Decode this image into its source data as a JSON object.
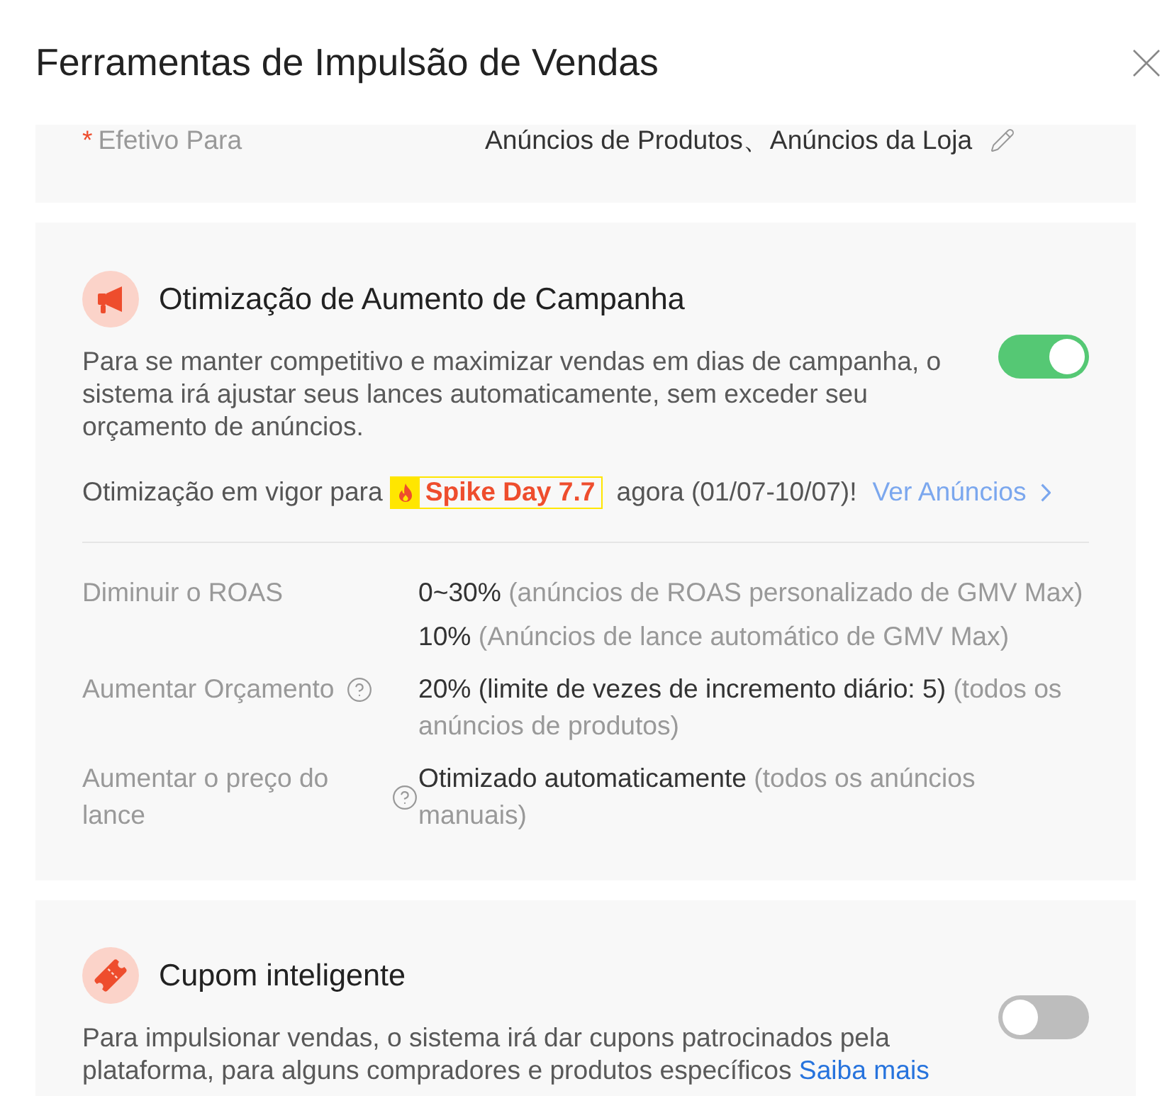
{
  "dialog": {
    "title": "Ferramentas de Impulsão de Vendas"
  },
  "target": {
    "required_mark": "*",
    "label": "Efetivo Para",
    "value": "Anúncios de Produtos、Anúncios da Loja"
  },
  "features": [
    {
      "kind": "boost",
      "title": "Otimização de Aumento de Campanha",
      "enabled": true,
      "description": "Para se manter competitivo e maximizar vendas em dias de campanha, o sistema irá ajustar seus lances automaticamente, sem exceder seu orçamento de anúncios.",
      "promo": {
        "prefix": "Otimização em vigor para",
        "event": "Spike Day 7.7",
        "suffix": "agora (01/07-10/07)!",
        "link": "Ver Anúncios"
      },
      "details": [
        {
          "label": "Diminuir o ROAS",
          "has_help": false,
          "values": [
            {
              "main": "0~30%",
              "note": "(anúncios de ROAS personalizado de GMV Max)"
            },
            {
              "main": "10%",
              "note": "(Anúncios de lance automático de GMV Max)"
            }
          ]
        },
        {
          "label": "Aumentar Orçamento",
          "has_help": true,
          "values": [
            {
              "main": "20% (limite de vezes de incremento diário: 5)",
              "note": "(todos os anúncios de produtos)"
            }
          ]
        },
        {
          "label": "Aumentar o preço do lance",
          "has_help": true,
          "values": [
            {
              "main": "Otimizado automaticamente",
              "note": "(todos os anúncios manuais)"
            }
          ]
        }
      ]
    },
    {
      "kind": "coupon",
      "title": "Cupom inteligente",
      "enabled": false,
      "description": "Para impulsionar vendas, o sistema irá dar cupons patrocinados pela plataforma, para alguns compradores e produtos específicos",
      "link": "Saiba mais"
    }
  ]
}
